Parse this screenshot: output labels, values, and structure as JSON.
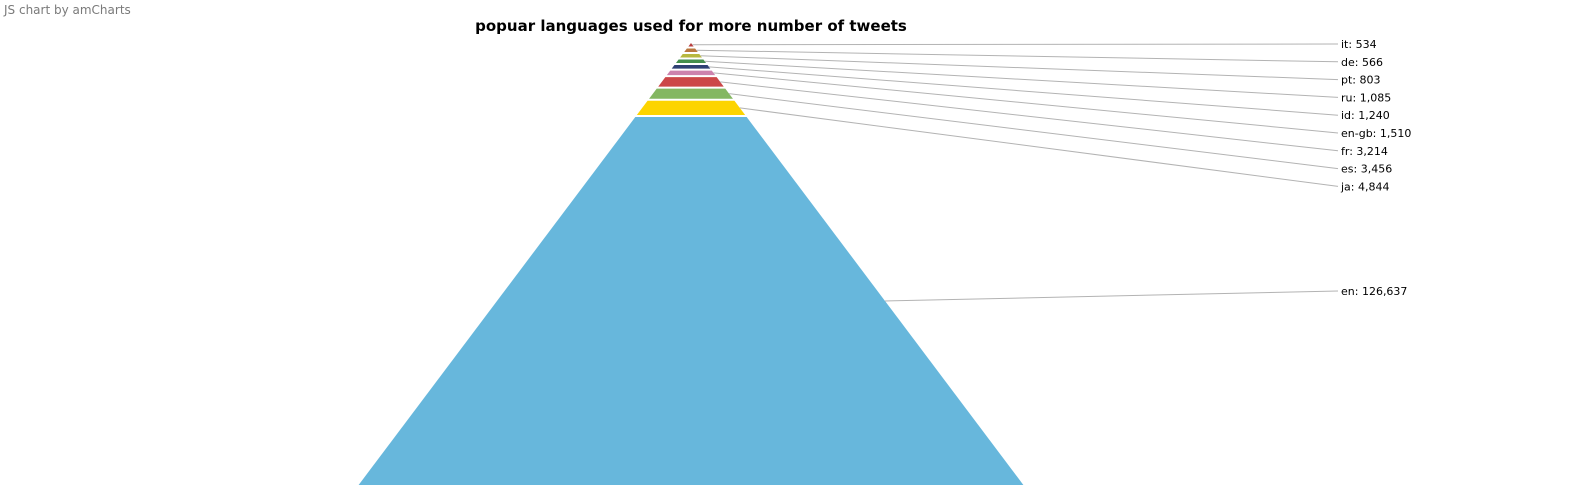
{
  "credit": "JS chart by amCharts",
  "chart_data": {
    "type": "pyramid",
    "title": "popuar languages used for more number of tweets",
    "items": [
      {
        "label": "en",
        "value": 126637,
        "display": "en: 126,637",
        "color": "#67b7dc"
      },
      {
        "label": "ja",
        "value": 4844,
        "display": "ja: 4,844",
        "color": "#fdd400"
      },
      {
        "label": "es",
        "value": 3456,
        "display": "es: 3,456",
        "color": "#84b761"
      },
      {
        "label": "fr",
        "value": 3214,
        "display": "fr: 3,214",
        "color": "#cc4748"
      },
      {
        "label": "en-gb",
        "value": 1510,
        "display": "en-gb: 1,510",
        "color": "#cd82ad"
      },
      {
        "label": "id",
        "value": 1240,
        "display": "id: 1,240",
        "color": "#2f4074"
      },
      {
        "label": "ru",
        "value": 1085,
        "display": "ru: 1,085",
        "color": "#448e4d"
      },
      {
        "label": "pt",
        "value": 803,
        "display": "pt: 803",
        "color": "#b7b83f"
      },
      {
        "label": "de",
        "value": 566,
        "display": "de: 566",
        "color": "#b9783f"
      },
      {
        "label": "it",
        "value": 534,
        "display": "it: 534",
        "color": "#b93e3d"
      }
    ],
    "label_order_top_to_bottom": [
      "it",
      "de",
      "pt",
      "ru",
      "id",
      "en-gb",
      "fr",
      "es",
      "ja",
      "en"
    ],
    "label_line_color": "#b3b3b3",
    "legend": "none"
  }
}
